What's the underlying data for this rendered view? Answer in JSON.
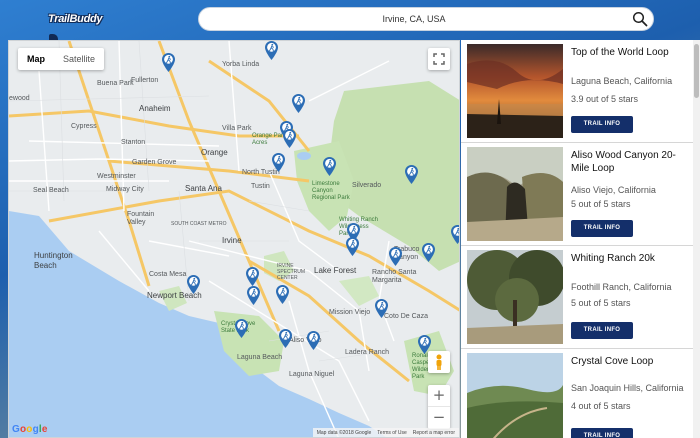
{
  "header": {
    "logo_text": "TrailBuddy",
    "search": {
      "value": "Irvine, CA, USA",
      "placeholder": ""
    }
  },
  "map": {
    "type_controls": [
      {
        "label": "Map",
        "active": true
      },
      {
        "label": "Satellite",
        "active": false
      }
    ],
    "zoom_in": "+",
    "zoom_out": "−",
    "google_logo": "Google",
    "footer": {
      "data": "Map data ©2018 Google",
      "terms": "Terms of Use",
      "report": "Report a map error"
    },
    "places": {
      "fullerton": "Fullerton",
      "yorba_linda": "Yorba Linda",
      "buena_park": "Buena Park",
      "anaheim": "Anaheim",
      "cypress": "Cypress",
      "villa_park": "Villa Park",
      "orange_park_acres": "Orange Park Acres",
      "stanton": "Stanton",
      "orange": "Orange",
      "garden_grove": "Garden Grove",
      "westminster": "Westminster",
      "north_tustin": "North Tustin",
      "silverado": "Silverado",
      "seal_beach": "Seal Beach",
      "midway_city": "Midway City",
      "santa_ana": "Santa Ana",
      "tustin": "Tustin",
      "limestone": "Limestone Canyon Regional Park",
      "fountain_valley": "Fountain Valley",
      "south_coast_metro": "SOUTH COAST METRO",
      "irvine": "Irvine",
      "whiting_ranch": "Whiting Ranch Wilderness Park",
      "trabuco": "Trabuco Canyon",
      "huntington_beach": "Huntington Beach",
      "lake_forest": "Lake Forest",
      "costa_mesa": "Costa Mesa",
      "spectrum": "IRVINE SPECTRUM CENTER",
      "rancho_santa_margarita": "Rancho Santa Margarita",
      "newport_beach": "Newport Beach",
      "mission_viejo": "Mission Viejo",
      "crystal_cove": "Crystal Cove State Park",
      "coto_de_caza": "Coto De Caza",
      "aliso_viejo": "Aliso Viejo",
      "ladera_ranch": "Ladera Ranch",
      "laguna_beach": "Laguna Beach",
      "ronald_caspers": "Ronald W. Caspers Wilderness Park",
      "laguna_niguel": "Laguna Niguel",
      "rossmoor": "ewood"
    }
  },
  "trails": [
    {
      "name": "Top of the World Loop",
      "location": "Laguna Beach, California",
      "rating": "3.9 out of 5 stars",
      "button": "TRAIL INFO"
    },
    {
      "name": "Aliso Wood Canyon 20-Mile Loop",
      "location": "Aliso Viejo, California",
      "rating": "5 out of 5 stars",
      "button": "TRAIL INFO"
    },
    {
      "name": "Whiting Ranch 20k",
      "location": "Foothill Ranch, California",
      "rating": "5 out of 5 stars",
      "button": "TRAIL INFO"
    },
    {
      "name": "Crystal Cove Loop",
      "location": "San Joaquin Hills, California",
      "rating": "4 out of 5 stars",
      "button": "TRAIL INFO"
    }
  ],
  "colors": {
    "accent": "#142f6a",
    "pin": "#2c6db5",
    "park": "#c8e3b4",
    "water": "#a9cdf3"
  },
  "icons": {
    "search": "search-icon",
    "pin": "hiker-pin-icon",
    "fullscreen": "fullscreen-icon",
    "pegman": "pegman-icon"
  }
}
